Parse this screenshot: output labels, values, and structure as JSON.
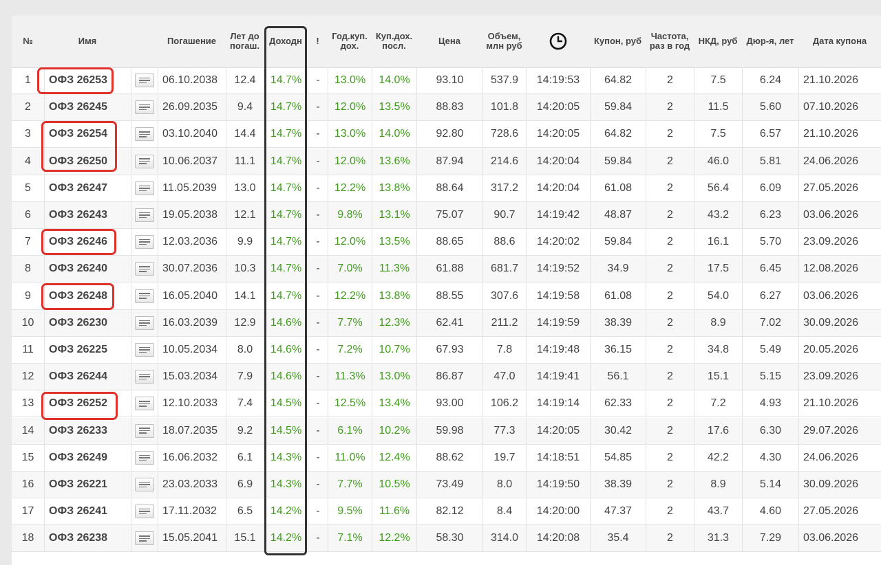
{
  "table": {
    "columns": [
      {
        "key": "num",
        "label": "№"
      },
      {
        "key": "name",
        "label": "Имя"
      },
      {
        "key": "note",
        "label": ""
      },
      {
        "key": "maturity",
        "label": "Погашение"
      },
      {
        "key": "years",
        "label": "Лет до погаш."
      },
      {
        "key": "yield",
        "label": "Доходн"
      },
      {
        "key": "flag",
        "label": "!"
      },
      {
        "key": "annual_coupon_yield",
        "label": "Год.куп. дох."
      },
      {
        "key": "last_coupon_yield",
        "label": "Куп.дох. посл."
      },
      {
        "key": "price",
        "label": "Цена"
      },
      {
        "key": "volume",
        "label": "Объем, млн руб"
      },
      {
        "key": "time",
        "label": ""
      },
      {
        "key": "coupon",
        "label": "Купон, руб"
      },
      {
        "key": "frequency",
        "label": "Частота, раз в год"
      },
      {
        "key": "nkd",
        "label": "НКД, руб"
      },
      {
        "key": "duration",
        "label": "Дюр-я, лет"
      },
      {
        "key": "coupon_date",
        "label": "Дата купона"
      }
    ],
    "time_icon": "clock-icon",
    "note_icon": "notes-icon",
    "rows": [
      {
        "num": "1",
        "name": "ОФЗ 26253",
        "maturity": "06.10.2038",
        "years": "12.4",
        "yield": "14.7%",
        "flag": "-",
        "annual_coupon_yield": "13.0%",
        "last_coupon_yield": "14.0%",
        "price": "93.10",
        "volume": "537.9",
        "time": "14:19:53",
        "coupon": "64.82",
        "frequency": "2",
        "nkd": "7.5",
        "duration": "6.24",
        "coupon_date": "21.10.2026"
      },
      {
        "num": "2",
        "name": "ОФЗ 26245",
        "maturity": "26.09.2035",
        "years": "9.4",
        "yield": "14.7%",
        "flag": "-",
        "annual_coupon_yield": "12.0%",
        "last_coupon_yield": "13.5%",
        "price": "88.83",
        "volume": "101.8",
        "time": "14:20:05",
        "coupon": "59.84",
        "frequency": "2",
        "nkd": "11.5",
        "duration": "5.60",
        "coupon_date": "07.10.2026"
      },
      {
        "num": "3",
        "name": "ОФЗ 26254",
        "maturity": "03.10.2040",
        "years": "14.4",
        "yield": "14.7%",
        "flag": "-",
        "annual_coupon_yield": "13.0%",
        "last_coupon_yield": "14.0%",
        "price": "92.80",
        "volume": "728.6",
        "time": "14:20:05",
        "coupon": "64.82",
        "frequency": "2",
        "nkd": "7.5",
        "duration": "6.57",
        "coupon_date": "21.10.2026"
      },
      {
        "num": "4",
        "name": "ОФЗ 26250",
        "maturity": "10.06.2037",
        "years": "11.1",
        "yield": "14.7%",
        "flag": "-",
        "annual_coupon_yield": "12.0%",
        "last_coupon_yield": "13.6%",
        "price": "87.94",
        "volume": "214.6",
        "time": "14:20:04",
        "coupon": "59.84",
        "frequency": "2",
        "nkd": "46.0",
        "duration": "5.81",
        "coupon_date": "24.06.2026"
      },
      {
        "num": "5",
        "name": "ОФЗ 26247",
        "maturity": "11.05.2039",
        "years": "13.0",
        "yield": "14.7%",
        "flag": "-",
        "annual_coupon_yield": "12.2%",
        "last_coupon_yield": "13.8%",
        "price": "88.64",
        "volume": "317.2",
        "time": "14:20:04",
        "coupon": "61.08",
        "frequency": "2",
        "nkd": "56.4",
        "duration": "6.09",
        "coupon_date": "27.05.2026"
      },
      {
        "num": "6",
        "name": "ОФЗ 26243",
        "maturity": "19.05.2038",
        "years": "12.1",
        "yield": "14.7%",
        "flag": "-",
        "annual_coupon_yield": "9.8%",
        "last_coupon_yield": "13.1%",
        "price": "75.07",
        "volume": "90.7",
        "time": "14:19:42",
        "coupon": "48.87",
        "frequency": "2",
        "nkd": "43.2",
        "duration": "6.23",
        "coupon_date": "03.06.2026"
      },
      {
        "num": "7",
        "name": "ОФЗ 26246",
        "maturity": "12.03.2036",
        "years": "9.9",
        "yield": "14.7%",
        "flag": "-",
        "annual_coupon_yield": "12.0%",
        "last_coupon_yield": "13.5%",
        "price": "88.65",
        "volume": "88.6",
        "time": "14:20:02",
        "coupon": "59.84",
        "frequency": "2",
        "nkd": "16.1",
        "duration": "5.70",
        "coupon_date": "23.09.2026"
      },
      {
        "num": "8",
        "name": "ОФЗ 26240",
        "maturity": "30.07.2036",
        "years": "10.3",
        "yield": "14.7%",
        "flag": "-",
        "annual_coupon_yield": "7.0%",
        "last_coupon_yield": "11.3%",
        "price": "61.88",
        "volume": "681.7",
        "time": "14:19:52",
        "coupon": "34.9",
        "frequency": "2",
        "nkd": "17.5",
        "duration": "6.45",
        "coupon_date": "12.08.2026"
      },
      {
        "num": "9",
        "name": "ОФЗ 26248",
        "maturity": "16.05.2040",
        "years": "14.1",
        "yield": "14.7%",
        "flag": "-",
        "annual_coupon_yield": "12.2%",
        "last_coupon_yield": "13.8%",
        "price": "88.55",
        "volume": "307.6",
        "time": "14:19:58",
        "coupon": "61.08",
        "frequency": "2",
        "nkd": "54.0",
        "duration": "6.27",
        "coupon_date": "03.06.2026"
      },
      {
        "num": "10",
        "name": "ОФЗ 26230",
        "maturity": "16.03.2039",
        "years": "12.9",
        "yield": "14.6%",
        "flag": "-",
        "annual_coupon_yield": "7.7%",
        "last_coupon_yield": "12.3%",
        "price": "62.41",
        "volume": "211.2",
        "time": "14:19:59",
        "coupon": "38.39",
        "frequency": "2",
        "nkd": "8.9",
        "duration": "7.02",
        "coupon_date": "30.09.2026"
      },
      {
        "num": "11",
        "name": "ОФЗ 26225",
        "maturity": "10.05.2034",
        "years": "8.0",
        "yield": "14.6%",
        "flag": "-",
        "annual_coupon_yield": "7.2%",
        "last_coupon_yield": "10.7%",
        "price": "67.93",
        "volume": "7.8",
        "time": "14:19:48",
        "coupon": "36.15",
        "frequency": "2",
        "nkd": "34.8",
        "duration": "5.49",
        "coupon_date": "20.05.2026"
      },
      {
        "num": "12",
        "name": "ОФЗ 26244",
        "maturity": "15.03.2034",
        "years": "7.9",
        "yield": "14.6%",
        "flag": "-",
        "annual_coupon_yield": "11.3%",
        "last_coupon_yield": "13.0%",
        "price": "86.87",
        "volume": "47.0",
        "time": "14:19:41",
        "coupon": "56.1",
        "frequency": "2",
        "nkd": "15.1",
        "duration": "5.15",
        "coupon_date": "23.09.2026"
      },
      {
        "num": "13",
        "name": "ОФЗ 26252",
        "maturity": "12.10.2033",
        "years": "7.4",
        "yield": "14.5%",
        "flag": "-",
        "annual_coupon_yield": "12.5%",
        "last_coupon_yield": "13.4%",
        "price": "93.00",
        "volume": "106.2",
        "time": "14:19:14",
        "coupon": "62.33",
        "frequency": "2",
        "nkd": "7.2",
        "duration": "4.93",
        "coupon_date": "21.10.2026"
      },
      {
        "num": "14",
        "name": "ОФЗ 26233",
        "maturity": "18.07.2035",
        "years": "9.2",
        "yield": "14.5%",
        "flag": "-",
        "annual_coupon_yield": "6.1%",
        "last_coupon_yield": "10.2%",
        "price": "59.98",
        "volume": "77.3",
        "time": "14:20:05",
        "coupon": "30.42",
        "frequency": "2",
        "nkd": "17.6",
        "duration": "6.30",
        "coupon_date": "29.07.2026"
      },
      {
        "num": "15",
        "name": "ОФЗ 26249",
        "maturity": "16.06.2032",
        "years": "6.1",
        "yield": "14.3%",
        "flag": "-",
        "annual_coupon_yield": "11.0%",
        "last_coupon_yield": "12.4%",
        "price": "88.62",
        "volume": "19.7",
        "time": "14:18:51",
        "coupon": "54.85",
        "frequency": "2",
        "nkd": "42.2",
        "duration": "4.30",
        "coupon_date": "24.06.2026"
      },
      {
        "num": "16",
        "name": "ОФЗ 26221",
        "maturity": "23.03.2033",
        "years": "6.9",
        "yield": "14.3%",
        "flag": "-",
        "annual_coupon_yield": "7.7%",
        "last_coupon_yield": "10.5%",
        "price": "73.49",
        "volume": "8.0",
        "time": "14:19:50",
        "coupon": "38.39",
        "frequency": "2",
        "nkd": "8.9",
        "duration": "5.14",
        "coupon_date": "30.09.2026"
      },
      {
        "num": "17",
        "name": "ОФЗ 26241",
        "maturity": "17.11.2032",
        "years": "6.5",
        "yield": "14.2%",
        "flag": "-",
        "annual_coupon_yield": "9.5%",
        "last_coupon_yield": "11.6%",
        "price": "82.12",
        "volume": "8.4",
        "time": "14:20:00",
        "coupon": "47.37",
        "frequency": "2",
        "nkd": "43.7",
        "duration": "4.60",
        "coupon_date": "27.05.2026"
      },
      {
        "num": "18",
        "name": "ОФЗ 26238",
        "maturity": "15.05.2041",
        "years": "15.1",
        "yield": "14.2%",
        "flag": "-",
        "annual_coupon_yield": "7.1%",
        "last_coupon_yield": "12.2%",
        "price": "58.30",
        "volume": "314.0",
        "time": "14:20:08",
        "coupon": "35.4",
        "frequency": "2",
        "nkd": "31.3",
        "duration": "7.29",
        "coupon_date": "03.06.2026"
      }
    ]
  },
  "highlights": {
    "red_outlined_names": [
      "ОФЗ 26253",
      "ОФЗ 26254",
      "ОФЗ 26250",
      "ОФЗ 26246",
      "ОФЗ 26248",
      "ОФЗ 26252"
    ],
    "outlined_column": "Доходн",
    "red_color": "#e0312b",
    "column_outline_color": "#333333"
  },
  "colors": {
    "positive": "#3f9c1a",
    "header_bg": "#f1f1f1",
    "text": "#444444"
  }
}
